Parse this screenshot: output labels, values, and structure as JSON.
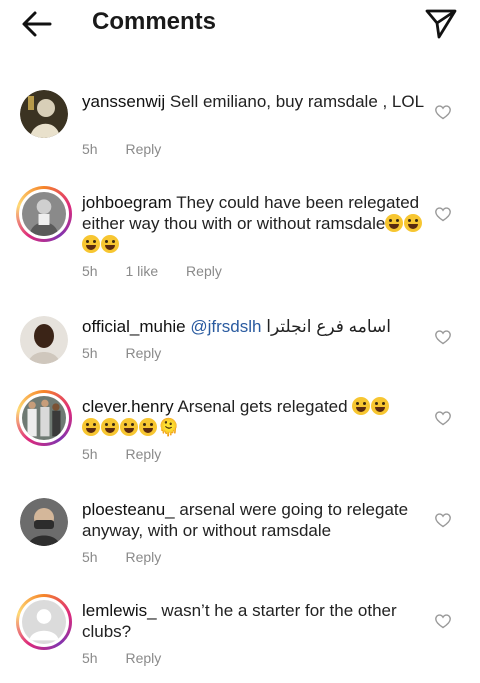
{
  "header": {
    "title": "Comments"
  },
  "comments": [
    {
      "username": "yanssenwij",
      "text": "Sell emiliano, buy ramsdale , LOL",
      "time": "5h",
      "reply": "Reply"
    },
    {
      "username": "johboegram",
      "text": "They could have been relegated either way thou with or without ramsdale",
      "emojis": [
        "😂",
        "😂",
        "😂",
        "😂"
      ],
      "time": "5h",
      "likes": "1 like",
      "reply": "Reply"
    },
    {
      "username": "official_muhie",
      "mention": "@jfrsdslh",
      "arabic": "اسامه فرع انجلترا",
      "time": "5h",
      "reply": "Reply"
    },
    {
      "username": "clever.henry",
      "text": "Arsenal gets relegated",
      "emojis": [
        "😭",
        "😃",
        "😃",
        "😂",
        "😅",
        "🤣"
      ],
      "tail": "🫠",
      "time": "5h",
      "reply": "Reply"
    },
    {
      "username": "ploesteanu_",
      "text": "arsenal were going to relegate anyway, with or without ramsdale",
      "time": "5h",
      "reply": "Reply"
    },
    {
      "username": "lemlewis_",
      "text": "wasn’t he a starter for the other clubs?",
      "time": "5h",
      "reply": "Reply"
    }
  ]
}
